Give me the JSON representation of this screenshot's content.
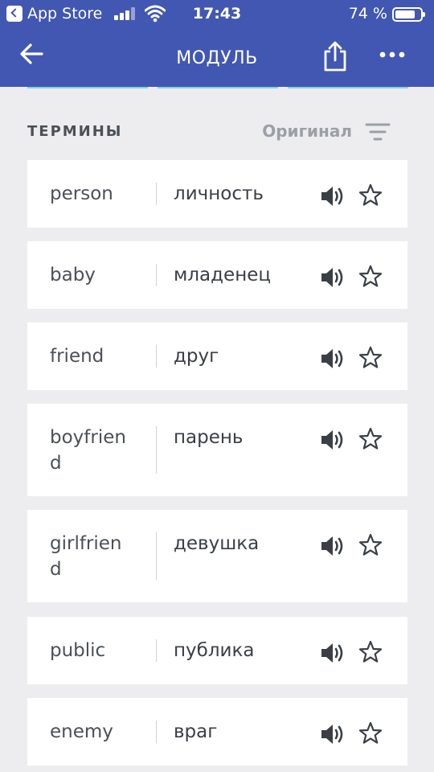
{
  "status_bar": {
    "back_app_label": "App Store",
    "time": "17:43",
    "battery_percent": "74 %",
    "battery_level": 0.74
  },
  "nav": {
    "title": "МОДУЛЬ",
    "icons": [
      "arrow-left-icon",
      "share-icon",
      "more-icon"
    ]
  },
  "section": {
    "label": "ТЕРМИНЫ",
    "sort_label": "Оригинал"
  },
  "terms": [
    {
      "term": "person",
      "definition": "личность"
    },
    {
      "term": "baby",
      "definition": "младенец"
    },
    {
      "term": "friend",
      "definition": "друг"
    },
    {
      "term": "boyfrien\nd",
      "definition": "парень"
    },
    {
      "term": "girlfrien\nd",
      "definition": "девушка"
    },
    {
      "term": "public",
      "definition": "публика"
    },
    {
      "term": "enemy",
      "definition": "враг"
    }
  ],
  "colors": {
    "header": "#4257b2",
    "background": "#ededf0",
    "card": "#ffffff",
    "accent": "#7fd3dc",
    "text": "#4b5057"
  }
}
